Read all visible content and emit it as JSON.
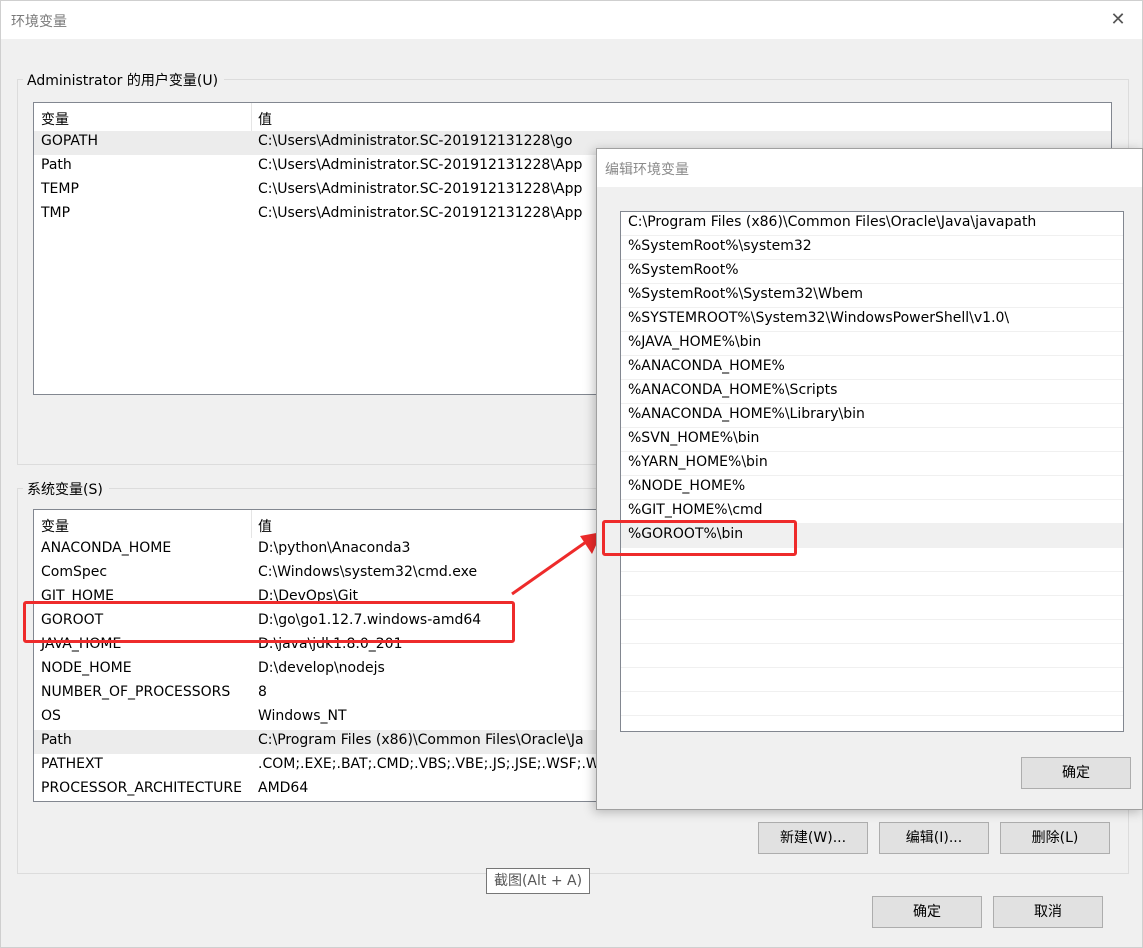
{
  "window": {
    "title": "环境变量",
    "close_glyph": "✕"
  },
  "user_vars": {
    "group_label": "Administrator 的用户变量(U)",
    "col_var": "变量",
    "col_val": "值",
    "rows": [
      {
        "name": "GOPATH",
        "value": "C:\\Users\\Administrator.SC-201912131228\\go"
      },
      {
        "name": "Path",
        "value": "C:\\Users\\Administrator.SC-201912131228\\App"
      },
      {
        "name": "TEMP",
        "value": "C:\\Users\\Administrator.SC-201912131228\\App"
      },
      {
        "name": "TMP",
        "value": "C:\\Users\\Administrator.SC-201912131228\\App"
      }
    ]
  },
  "sys_vars": {
    "group_label": "系统变量(S)",
    "col_var": "变量",
    "col_val": "值",
    "rows": [
      {
        "name": "ANACONDA_HOME",
        "value": "D:\\python\\Anaconda3"
      },
      {
        "name": "ComSpec",
        "value": "C:\\Windows\\system32\\cmd.exe"
      },
      {
        "name": "GIT_HOME",
        "value": "D:\\DevOps\\Git"
      },
      {
        "name": "GOROOT",
        "value": "D:\\go\\go1.12.7.windows-amd64"
      },
      {
        "name": "JAVA_HOME",
        "value": "D:\\java\\jdk1.8.0_201"
      },
      {
        "name": "NODE_HOME",
        "value": "D:\\develop\\nodejs"
      },
      {
        "name": "NUMBER_OF_PROCESSORS",
        "value": "8"
      },
      {
        "name": "OS",
        "value": "Windows_NT"
      },
      {
        "name": "Path",
        "value": "C:\\Program Files (x86)\\Common Files\\Oracle\\Ja"
      },
      {
        "name": "PATHEXT",
        "value": ".COM;.EXE;.BAT;.CMD;.VBS;.VBE;.JS;.JSE;.WSF;.W"
      },
      {
        "name": "PROCESSOR_ARCHITECTURE",
        "value": "AMD64"
      }
    ],
    "buttons": {
      "new": "新建(W)...",
      "edit": "编辑(I)...",
      "delete": "删除(L)"
    }
  },
  "tooltip": "截图(Alt + A)",
  "footer": {
    "ok": "确定",
    "cancel": "取消"
  },
  "edit_dialog": {
    "title": "编辑环境变量",
    "entries": [
      "C:\\Program Files (x86)\\Common Files\\Oracle\\Java\\javapath",
      "%SystemRoot%\\system32",
      "%SystemRoot%",
      "%SystemRoot%\\System32\\Wbem",
      "%SYSTEMROOT%\\System32\\WindowsPowerShell\\v1.0\\",
      "%JAVA_HOME%\\bin",
      "%ANACONDA_HOME%",
      "%ANACONDA_HOME%\\Scripts",
      "%ANACONDA_HOME%\\Library\\bin",
      "%SVN_HOME%\\bin",
      "%YARN_HOME%\\bin",
      "%NODE_HOME%",
      "%GIT_HOME%\\cmd",
      "%GOROOT%\\bin"
    ],
    "ok": "确定"
  },
  "colors": {
    "highlight_red": "#ee2b2b",
    "focus_blue": "#0078d7"
  }
}
